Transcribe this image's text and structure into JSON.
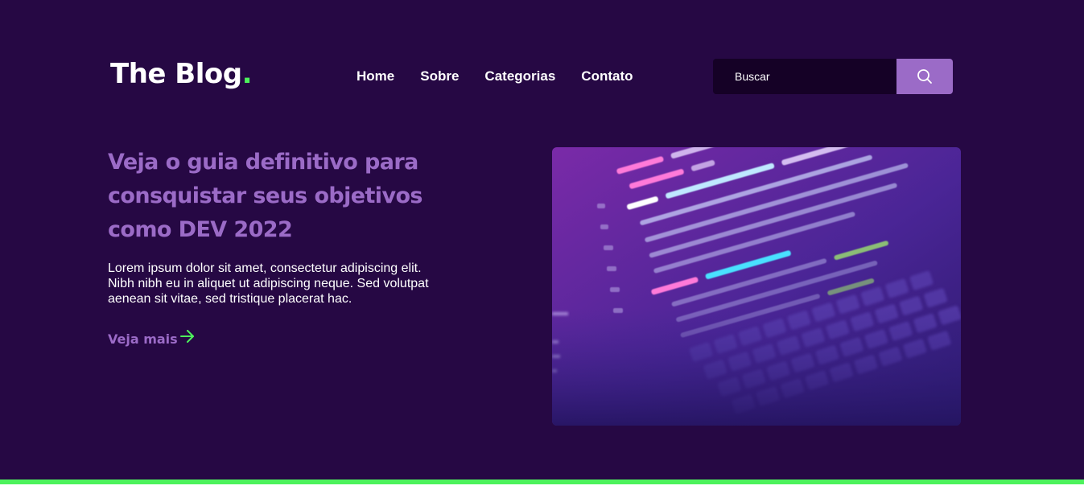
{
  "brand": {
    "name": "The Blog",
    "dot": ".",
    "accent_color": "#4df25c"
  },
  "nav": {
    "items": [
      {
        "label": "Home"
      },
      {
        "label": "Sobre"
      },
      {
        "label": "Categorias"
      },
      {
        "label": "Contato"
      }
    ]
  },
  "search": {
    "placeholder": "Buscar",
    "value": "",
    "icon": "search-icon"
  },
  "hero": {
    "headline": "Veja o guia definitivo para consquistar seus objetivos como DEV 2022",
    "excerpt": "Lorem ipsum dolor sit amet, consectetur adipiscing elit. Nibh nibh eu in aliquet ut adipiscing neque. Sed volutpat aenean sit vitae, sed tristique placerat hac.",
    "cta_label": "Veja mais",
    "cta_icon": "arrow-right-icon",
    "image": "laptop-code-photo"
  },
  "colors": {
    "background": "#260844",
    "accent_purple": "#9b6bc7",
    "accent_green": "#4df25c",
    "search_field": "#150126"
  }
}
